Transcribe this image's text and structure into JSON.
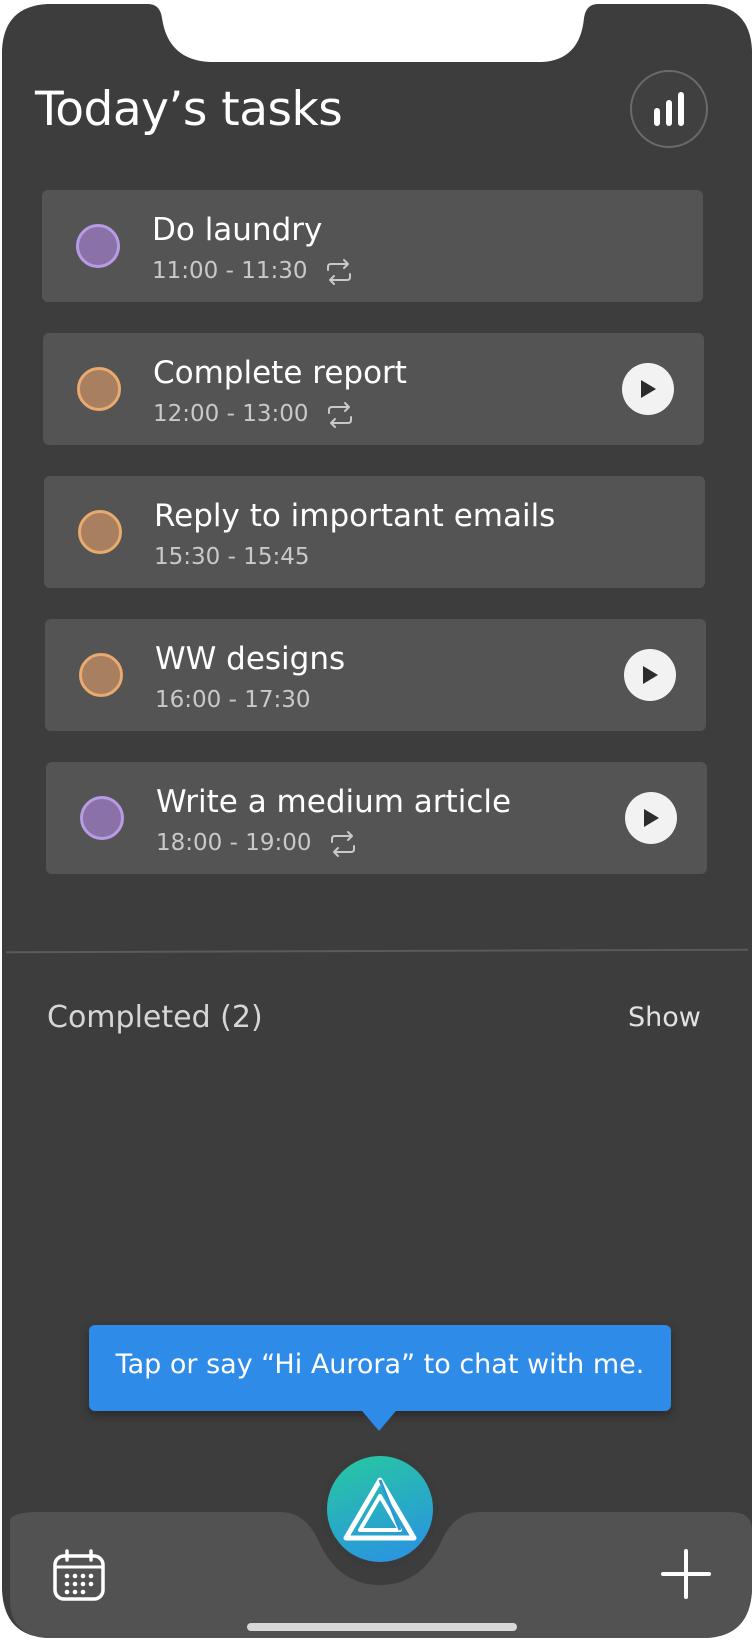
{
  "header": {
    "title": "Today’s tasks",
    "stats_icon": "bar-chart-icon"
  },
  "tasks": [
    {
      "name": "Do laundry",
      "time": "11:00 - 11:30",
      "color": "purple",
      "repeat": true,
      "play": false
    },
    {
      "name": "Complete report",
      "time": "12:00 - 13:00",
      "color": "orange",
      "repeat": true,
      "play": true
    },
    {
      "name": "Reply to important emails",
      "time": "15:30 - 15:45",
      "color": "orange",
      "repeat": false,
      "play": false
    },
    {
      "name": "WW designs",
      "time": "16:00 - 17:30",
      "color": "orange",
      "repeat": false,
      "play": true
    },
    {
      "name": "Write a medium article",
      "time": "18:00 - 19:00",
      "color": "purple",
      "repeat": true,
      "play": true
    }
  ],
  "completed": {
    "label": "Completed (2)",
    "toggle_label": "Show"
  },
  "assistant": {
    "tooltip": "Tap or say “Hi Aurora” to chat with me.",
    "icon": "aurora-logo-icon"
  },
  "bottom_bar": {
    "left_icon": "calendar-icon",
    "right_icon": "plus-icon"
  },
  "colors": {
    "background": "#3d3d3d",
    "card": "#545454",
    "accent_blue": "#2e8be8",
    "purple_dot": "#8a72a8",
    "orange_dot": "#a88060"
  }
}
